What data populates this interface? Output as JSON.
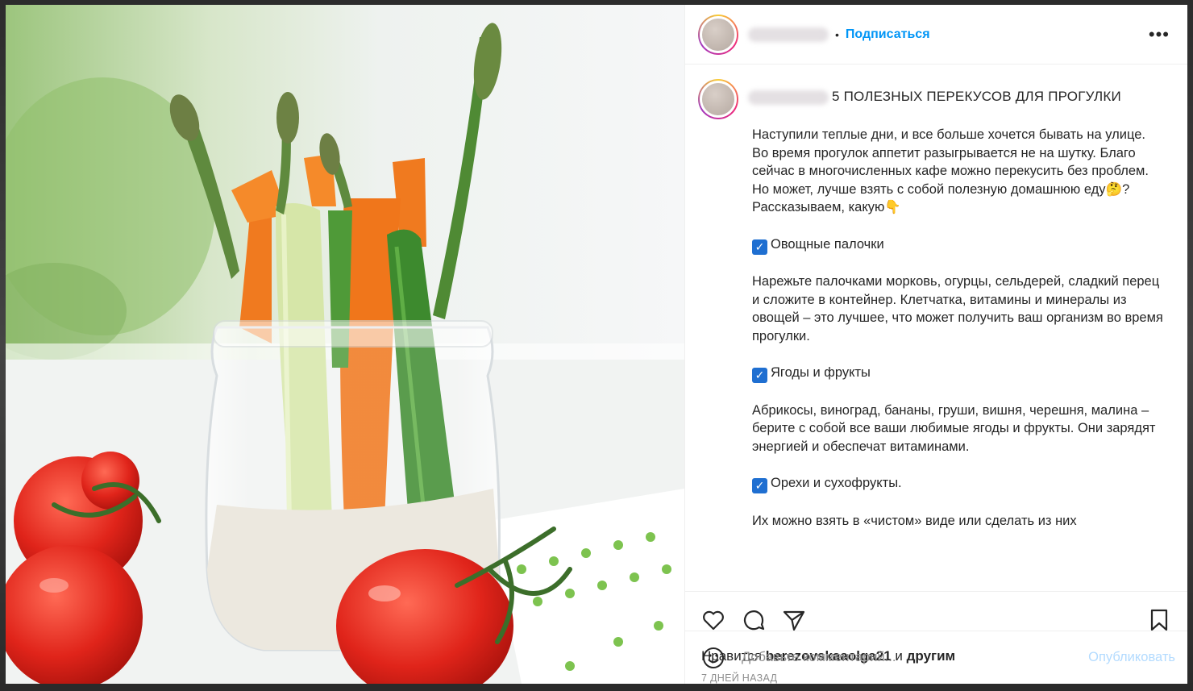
{
  "colors": {
    "link": "#0095f6",
    "text": "#262626",
    "muted": "#8e8e8e",
    "publish_disabled": "#b3dbff",
    "checkbox": "#1f6fd1"
  },
  "header": {
    "separator": "•",
    "follow_label": "Подписаться",
    "more_label": "•••"
  },
  "caption": {
    "title": "5 ПОЛЕЗНЫХ ПЕРЕКУСОВ ДЛЯ ПРОГУЛКИ",
    "intro_1": "Наступили теплые дни, и все больше хочется бывать на улице. Во время прогулок аппетит разыгрывается не на шутку. Благо сейчас в многочисленных кафе можно перекусить без проблем. Но может, лучше взять с собой полезную домашнюю еду",
    "intro_emoji": "🤔",
    "intro_2": "? Рассказываем, какую",
    "intro_emoji_2": "👇",
    "check_glyph": "✓",
    "item_1_title": "Овощные палочки",
    "item_1_text": "Нарежьте палочками морковь, огурцы, сельдерей, сладкий перец и сложите в контейнер. Клетчатка, витамины и минералы из овощей – это лучшее, что может получить ваш организм во время прогулки.",
    "item_2_title": "Ягоды и фрукты",
    "item_2_text": "Абрикосы, виноград, бананы, груши, вишня, черешня, малина – берите с собой все ваши любимые ягоды и фрукты. Они зарядят энергией и обеспечат витаминами.",
    "item_3_title": "Орехи и сухофрукты.",
    "item_3_text": "Их можно взять в «чистом» виде или сделать из них"
  },
  "actions": {
    "like_icon": "heart-icon",
    "comment_icon": "speech-bubble-icon",
    "share_icon": "paper-plane-icon",
    "save_icon": "bookmark-icon"
  },
  "likes": {
    "prefix": "Нравится ",
    "user": "berezovskaaolga21",
    "middle": " и ",
    "others": "другим"
  },
  "date": "7 ДНЕЙ НАЗАД",
  "comment_box": {
    "placeholder": "Добавьте комментарий...",
    "publish_label": "Опубликовать"
  }
}
